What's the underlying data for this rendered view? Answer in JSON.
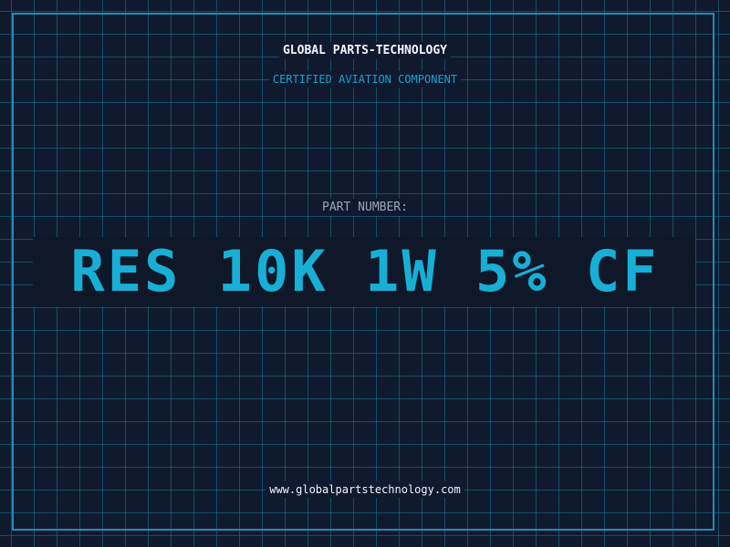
{
  "header": {
    "company": "GLOBAL PARTS-TECHNOLOGY",
    "tagline": "CERTIFIED AVIATION COMPONENT"
  },
  "part": {
    "label": "PART NUMBER:",
    "value": "RES 10K 1W 5% CF"
  },
  "footer": {
    "website": "www.globalpartstechnology.com"
  },
  "colors": {
    "background": "#101a2e",
    "grid": "#16789a",
    "accent": "#17afd6",
    "border": "#1b8fb8",
    "text": "#f2f5fa",
    "muted": "#9aa6b8"
  }
}
